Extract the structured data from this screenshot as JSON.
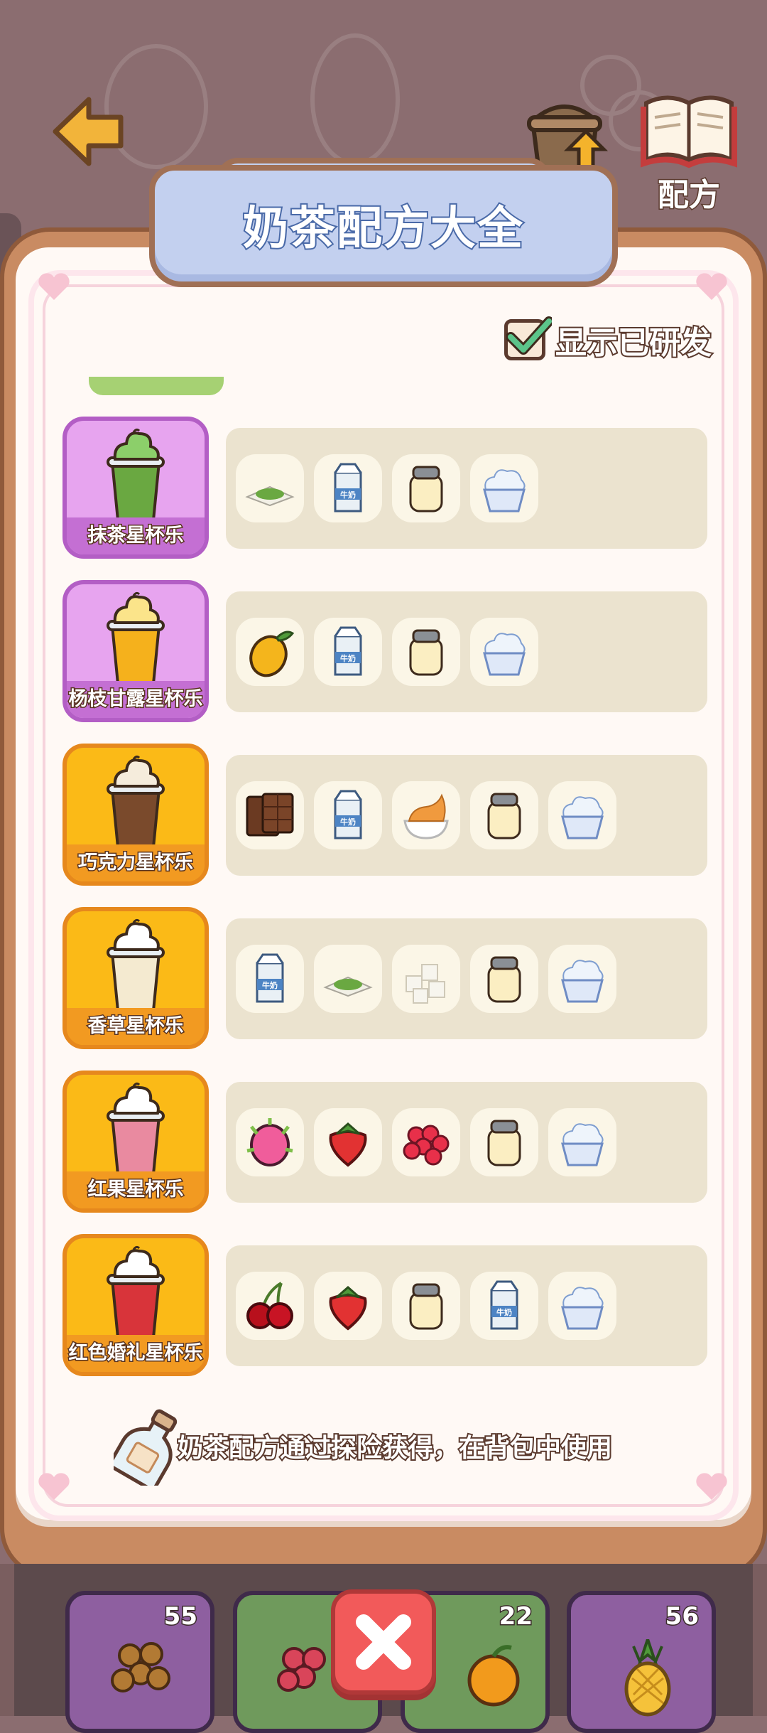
{
  "header": {
    "recipe_button_label": "配方"
  },
  "title": "奶茶配方大全",
  "show_developed": {
    "label": "显示已研发",
    "checked": true
  },
  "recipes": [
    {
      "name": "抹茶星杯乐",
      "color": "purple",
      "drink": "matcha",
      "ingredients": [
        "matcha-powder",
        "milk",
        "jar",
        "ice-cream"
      ]
    },
    {
      "name": "杨枝甘露星杯乐",
      "color": "purple",
      "drink": "mango",
      "ingredients": [
        "mango",
        "milk",
        "jar",
        "ice-cream"
      ]
    },
    {
      "name": "巧克力星杯乐",
      "color": "orange",
      "drink": "chocolate",
      "ingredients": [
        "chocolate-bar",
        "milk",
        "caramel-cream",
        "jar",
        "ice-cream"
      ]
    },
    {
      "name": "香草星杯乐",
      "color": "orange",
      "drink": "vanilla",
      "ingredients": [
        "milk",
        "matcha-powder",
        "sugar-cubes",
        "jar",
        "ice-cream"
      ]
    },
    {
      "name": "红果星杯乐",
      "color": "orange",
      "drink": "redfruit",
      "ingredients": [
        "dragon-fruit",
        "strawberry",
        "raspberry",
        "jar",
        "ice-cream"
      ]
    },
    {
      "name": "红色婚礼星杯乐",
      "color": "orange",
      "drink": "wedding",
      "ingredients": [
        "cherry",
        "strawberry",
        "jar",
        "milk",
        "ice-cream"
      ]
    }
  ],
  "footer_note": "奶茶配方通过探险获得，在背包中使用",
  "milk_label": "牛奶",
  "inventory": [
    {
      "item": "boba",
      "count": "55"
    },
    {
      "item": "grape",
      "count": ""
    },
    {
      "item": "orange",
      "count": "22"
    },
    {
      "item": "pineapple",
      "count": "56"
    }
  ],
  "colors": {
    "purple_card": "#e7a4ef",
    "orange_card": "#fbba17",
    "banner": "#c3d0ef",
    "close": "#f25a5a"
  }
}
